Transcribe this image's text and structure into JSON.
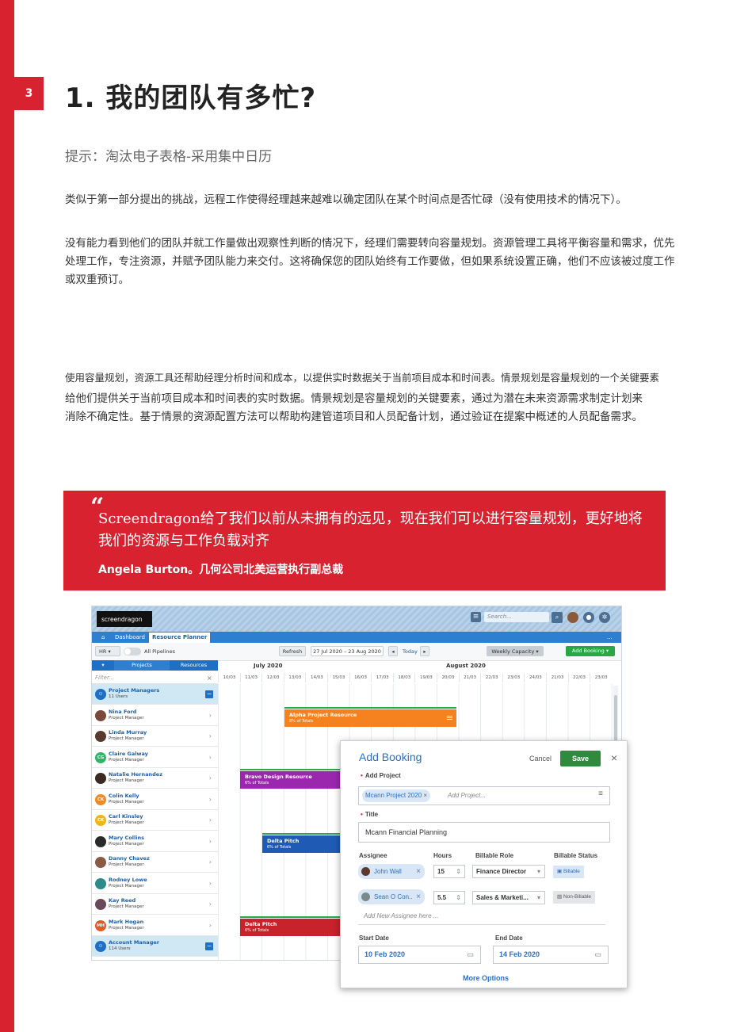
{
  "page": {
    "number": "3",
    "title": "1. 我的团队有多忙?",
    "hint": "提示：淘汰电子表格-采用集中日历",
    "para1": "类似于第一部分提出的挑战，远程工作使得经理越来越难以确定团队在某个时间点是否忙碌（没有使用技术的情况下）。",
    "para2": "没有能力看到他们的团队并就工作量做出观察性判断的情况下，经理们需要转向容量规划。资源管理工具将平衡容量和需求，优先处理工作，专注资源，并赋予团队能力来交付。这将确保您的团队始终有工作要做，但如果系统设置正确，他们不应该被过度工作或双重预订。",
    "note": "使用容量规划，资源工具还帮助经理分析时间和成本，以提供实时数据关于当前项目成本和时间表。情景规划是容量规划的一个关键要素",
    "para3": "给他们提供关于当前项目成本和时间表的实时数据。情景规划是容量规划的关键要素，通过为潜在未来资源需求制定计划来消除不确定性。基于情景的资源配置方法可以帮助构建管道项目和人员配备计划，通过验证在提案中概述的人员配备需求。"
  },
  "quote": {
    "mark": "“",
    "text": "Screendragon给了我们以前从未拥有的远见，现在我们可以进行容量规划，更好地将我们的资源与工作负载对齐",
    "author": "Angela Burton。几何公司北美运营执行副总裁"
  },
  "app": {
    "logo": "screendragon",
    "search_placeholder": "Search...",
    "tabs": {
      "dashboard": "Dashboard",
      "resource_planner": "Resource Planner",
      "more": "..."
    },
    "toolbar": {
      "filter": "HR",
      "all_pipelines": "All Pipelines",
      "refresh": "Refresh",
      "date_range": "27 Jul 2020 – 23 Aug 2020",
      "today": "Today",
      "capacity": "Weekly Capacity",
      "add_booking": "Add Booking"
    },
    "columns": {
      "projects": "Projects",
      "resources": "Resources"
    },
    "months": {
      "july": "July 2020",
      "august": "August 2020"
    },
    "days": [
      "10/03",
      "11/03",
      "12/03",
      "13/03",
      "14/03",
      "15/03",
      "16/03",
      "17/03",
      "18/03",
      "19/03",
      "20/03",
      "21/03",
      "22/03",
      "23/03",
      "24/03",
      "21/03",
      "22/03",
      "23/03"
    ],
    "filter_placeholder": "Filter...",
    "rows": [
      {
        "name": "Project Managers",
        "role": "11 Users",
        "initials": "",
        "color": "#1f6fc4",
        "group": true
      },
      {
        "name": "Nina Ford",
        "role": "Project Manager",
        "initials": "",
        "color": "#7a4a3a"
      },
      {
        "name": "Linda Murray",
        "role": "Project Manager",
        "initials": "",
        "color": "#5a3a2e"
      },
      {
        "name": "Claire Galway",
        "role": "Project Manager",
        "initials": "CG",
        "color": "#34b36b"
      },
      {
        "name": "Natalie Hernandez",
        "role": "Project Manager",
        "initials": "",
        "color": "#3a2a22"
      },
      {
        "name": "Colin Kelly",
        "role": "Project Manager",
        "initials": "CK",
        "color": "#f08a24"
      },
      {
        "name": "Carl Kinsley",
        "role": "Project Manager",
        "initials": "CK",
        "color": "#f2b418"
      },
      {
        "name": "Mary Collins",
        "role": "Project Manager",
        "initials": "",
        "color": "#2a2a2a"
      },
      {
        "name": "Danny Chavez",
        "role": "Project Manager",
        "initials": "",
        "color": "#8a5a44"
      },
      {
        "name": "Rodney Lowe",
        "role": "Project Manager",
        "initials": "",
        "color": "#2f8a8a"
      },
      {
        "name": "Kay Reed",
        "role": "Project Manager",
        "initials": "",
        "color": "#6a4a5a"
      },
      {
        "name": "Mark Hogan",
        "role": "Project Manager",
        "initials": "MH",
        "color": "#e05a2a"
      },
      {
        "name": "Account Manager",
        "role": "114 Users",
        "initials": "",
        "color": "#1f6fc4",
        "group": true
      }
    ],
    "bars": {
      "alpha": {
        "title": "Alpha Project Resource",
        "sub": "8% of Totals",
        "color": "#f5821f"
      },
      "bravo": {
        "title": "Bravo Design Resource",
        "sub": "6% of Totals",
        "color": "#9b27af"
      },
      "delta1": {
        "title": "Delta Pitch",
        "sub": "6% of Totals",
        "color": "#1f5bb5"
      },
      "delta2": {
        "title": "Delta Pitch",
        "sub": "6% of Totals",
        "color": "#c8222a"
      }
    }
  },
  "dialog": {
    "title": "Add Booking",
    "cancel": "Cancel",
    "save": "Save",
    "close": "×",
    "add_project_label": "Add Project",
    "project_chip": "Mcann Project 2020",
    "add_project_placeholder": "Add Project...",
    "title_label": "Title",
    "title_value": "Mcann Financial Planning",
    "headers": {
      "assignee": "Assignee",
      "hours": "Hours",
      "role": "Billable Role",
      "status": "Billable Status"
    },
    "assignees": [
      {
        "name": "John Wall",
        "hours": "15",
        "role": "Finance Director",
        "status": "Billable"
      },
      {
        "name": "Sean O Con..",
        "hours": "5.5",
        "role": "Sales & Marketi...",
        "status": "Non-Billable"
      }
    ],
    "add_assignee_placeholder": "Add New Assignee here ...",
    "start_label": "Start Date",
    "start_value": "10 Feb 2020",
    "end_label": "End Date",
    "end_value": "14 Feb 2020",
    "more": "More Options"
  }
}
